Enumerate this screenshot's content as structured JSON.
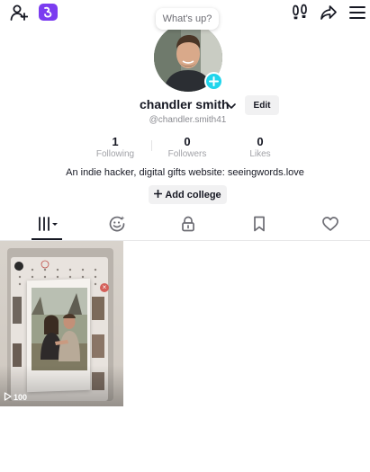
{
  "bubble": {
    "text": "What's up?"
  },
  "profile": {
    "name": "chandler smith",
    "handle": "@chandler.smith41",
    "edit_label": "Edit",
    "bio": "An indie hacker, digital gifts website: seeingwords.love",
    "add_college_label": "Add college"
  },
  "stats": {
    "following": {
      "value": "1",
      "label": "Following"
    },
    "followers": {
      "value": "0",
      "label": "Followers"
    },
    "likes": {
      "value": "0",
      "label": "Likes"
    }
  },
  "icons": {
    "top_left": [
      "add-user-icon",
      "app-badge-icon"
    ],
    "top_right": [
      "footprint-icon",
      "share-icon",
      "menu-icon"
    ],
    "tabs": [
      "grid-videos-icon",
      "reposts-icon",
      "lock-icon",
      "bookmark-icon",
      "heart-icon"
    ]
  },
  "videos": [
    {
      "views": "100"
    }
  ],
  "colors": {
    "accent_badge": "#7b3cf0",
    "avatar_add": "#20d5ec",
    "primary_text": "#161823",
    "secondary_text": "#8a8b91"
  }
}
